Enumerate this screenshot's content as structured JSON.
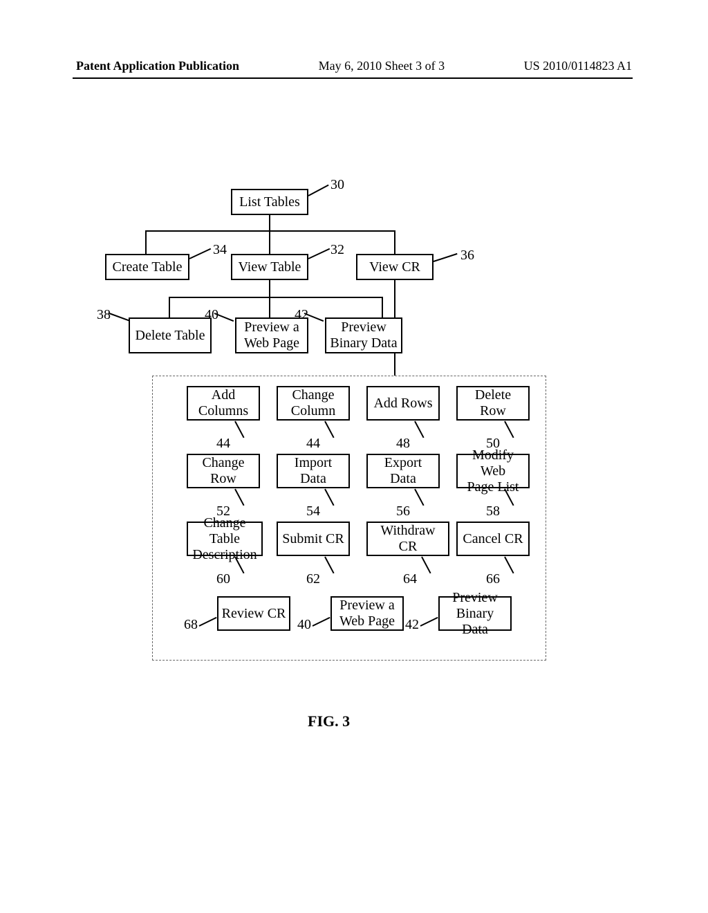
{
  "header": {
    "left": "Patent Application Publication",
    "mid": "May 6, 2010  Sheet 3 of 3",
    "right": "US 2010/0114823 A1"
  },
  "boxes": {
    "n30": "List Tables",
    "n34": "Create Table",
    "n32": "View Table",
    "n36": "View CR",
    "n38": "Delete Table",
    "n40a": "Preview a\nWeb Page",
    "n42a": "Preview\nBinary Data",
    "g44a": "Add\nColumns",
    "g44b": "Change\nColumn",
    "g48": "Add Rows",
    "g50": "Delete Row",
    "g52": "Change Row",
    "g54": "Import Data",
    "g56": "Export Data",
    "g58": "Modify Web\nPage List",
    "g60": "Change Table\nDescription",
    "g62": "Submit CR",
    "g64": "Withdraw CR",
    "g66": "Cancel CR",
    "g68": "Review CR",
    "n40b": "Preview a\nWeb Page",
    "n42b": "Preview\nBinary Data"
  },
  "refs": {
    "r30": "30",
    "r32": "32",
    "r34": "34",
    "r36": "36",
    "r38": "38",
    "r40a": "40",
    "r42a": "42",
    "r44a": "44",
    "r44b": "44",
    "r48": "48",
    "r50": "50",
    "r52": "52",
    "r54": "54",
    "r56": "56",
    "r58": "58",
    "r60": "60",
    "r62": "62",
    "r64": "64",
    "r66": "66",
    "r68": "68",
    "r40b": "40",
    "r42b": "42"
  },
  "figure": "FIG. 3"
}
